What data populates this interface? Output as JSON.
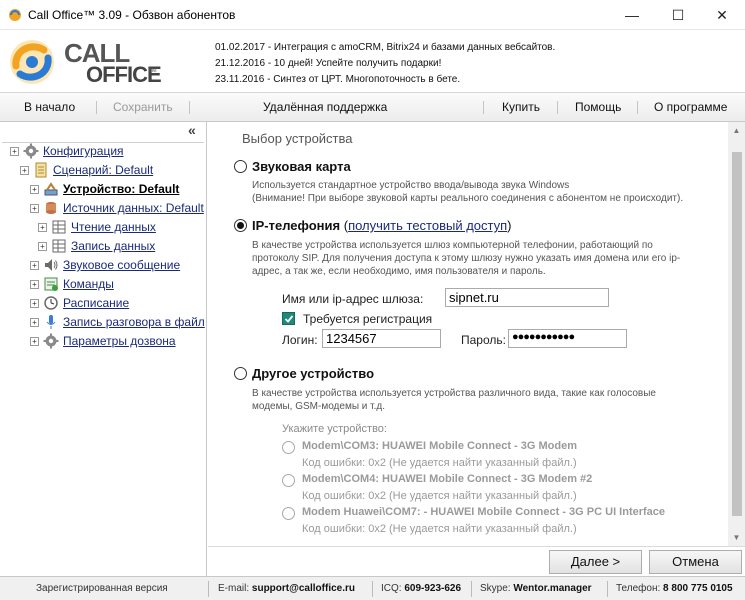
{
  "window": {
    "title": "Call Office™ 3.09 - Обзвон абонентов",
    "controls": {
      "minimize": "—",
      "maximize": "☐",
      "close": "✕"
    }
  },
  "logo": {
    "word1": "CALL",
    "word2": "OFFICE",
    "tm": "TM"
  },
  "news": [
    "01.02.2017 - Интеграция с amoCRM, Bitrix24 и базами данных вебсайтов.",
    "21.12.2016 - 10 дней! Успейте получить подарки!",
    "23.11.2016 - Синтез от ЦРТ. Многопоточность в бете."
  ],
  "menu": {
    "home": "В начало",
    "save": "Сохранить",
    "remote": "Удалённая поддержка",
    "buy": "Купить",
    "help": "Помощь",
    "about": "О программе"
  },
  "tree": {
    "collapse": "«",
    "items": [
      {
        "label": "Конфигурация",
        "bold": false
      },
      {
        "label": "Сценарий: Default",
        "bold": false
      },
      {
        "label": "Устройство: Default",
        "bold": true
      },
      {
        "label": "Источник данных: Default",
        "bold": false
      },
      {
        "label": "Чтение данных",
        "bold": false
      },
      {
        "label": "Запись данных",
        "bold": false
      },
      {
        "label": "Звуковое сообщение",
        "bold": false
      },
      {
        "label": "Команды",
        "bold": false
      },
      {
        "label": "Расписание",
        "bold": false
      },
      {
        "label": "Запись разговора в файл",
        "bold": false
      },
      {
        "label": "Параметры дозвона",
        "bold": false
      }
    ]
  },
  "main": {
    "section_title": "Выбор устройства",
    "sound": {
      "label": "Звуковая карта",
      "desc1": "Используется стандартное устройство ввода/вывода звука Windows",
      "desc2": "(Внимание! При выборе звуковой карты реального соединения с абонентом не происходит)."
    },
    "ip": {
      "label": "IP-телефония",
      "link_open": " (",
      "link": "получить тестовый доступ",
      "link_close": ")",
      "desc1": "В качестве устройства используется шлюз компьютерной телефонии, работающий по",
      "desc2": "протоколу SIP. Для получения доступа к этому шлюзу нужно указать имя домена или его ip-",
      "desc3": "адрес, а так же, если необходимо, имя пользователя и пароль.",
      "gateway_label": "Имя или ip-адрес шлюза:",
      "gateway_value": "sipnet.ru",
      "reg_label": "Требуется регистрация",
      "login_label": "Логин:",
      "login_value": "1234567",
      "password_label": "Пароль:",
      "password_value": "●●●●●●●●●●●"
    },
    "other": {
      "label": "Другое устройство",
      "desc1": "В качестве устройства используется устройства различного вида, такие как голосовые",
      "desc2": "модемы, GSM-модемы и т.д.",
      "specify": "Укажите устройство:",
      "devices": [
        {
          "name": "Modem\\COM3: HUAWEI Mobile Connect - 3G Modem",
          "error": "Код ошибки: 0x2 (Не удается найти указанный файл.)"
        },
        {
          "name": "Modem\\COM4: HUAWEI Mobile Connect - 3G Modem #2",
          "error": "Код ошибки: 0x2 (Не удается найти указанный файл.)"
        },
        {
          "name": "Modem Huawei\\COM7: - HUAWEI Mobile Connect - 3G PC UI Interface",
          "error": "Код ошибки: 0x2 (Не удается найти указанный файл.)"
        }
      ]
    }
  },
  "buttons": {
    "next": "Далее >",
    "cancel": "Отмена"
  },
  "status": {
    "registered": "Зарегистрированная версия",
    "email_label": "E-mail: ",
    "email": "support@calloffice.ru",
    "icq_label": "ICQ: ",
    "icq": "609-923-626",
    "skype_label": "Skype: ",
    "skype": "Wentor.manager",
    "phone_label": "Телефон: ",
    "phone": "8 800 775 0105"
  },
  "colors": {
    "accent_link": "#1a2a7a",
    "checkbox": "#1f8a7a"
  }
}
